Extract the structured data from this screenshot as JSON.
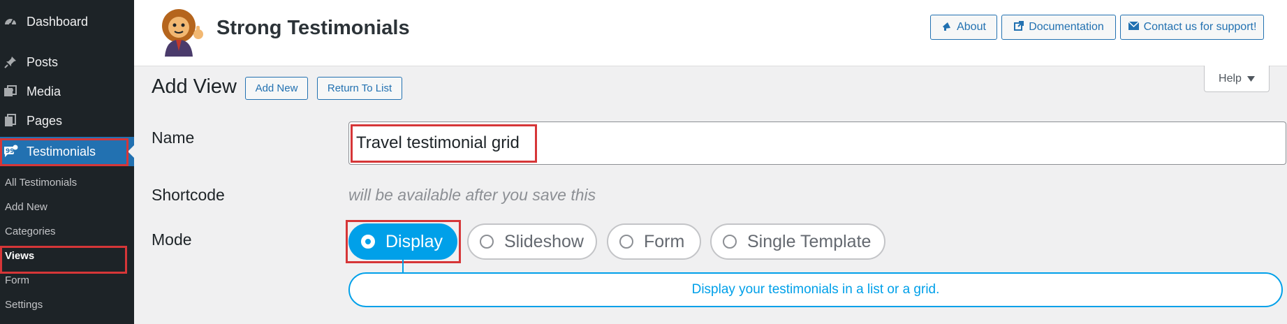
{
  "sidebar": {
    "menu": [
      {
        "label": "Dashboard",
        "icon": "dashboard-icon"
      },
      {
        "label": "Posts",
        "icon": "pushpin-icon"
      },
      {
        "label": "Media",
        "icon": "media-icon"
      },
      {
        "label": "Pages",
        "icon": "pages-icon"
      },
      {
        "label": "Testimonials",
        "icon": "testimonials-icon",
        "active": true
      }
    ],
    "submenu": [
      {
        "label": "All Testimonials"
      },
      {
        "label": "Add New"
      },
      {
        "label": "Categories"
      },
      {
        "label": "Views",
        "current": true
      },
      {
        "label": "Form"
      },
      {
        "label": "Settings"
      }
    ]
  },
  "header": {
    "plugin_title": "Strong Testimonials",
    "buttons": {
      "about": "About",
      "documentation": "Documentation",
      "contact": "Contact us for support!"
    }
  },
  "page": {
    "title": "Add View",
    "add_new": "Add New",
    "return_to_list": "Return To List",
    "help": "Help"
  },
  "form": {
    "name_label": "Name",
    "name_value": "Travel testimonial grid",
    "shortcode_label": "Shortcode",
    "shortcode_note": "will be available after you save this",
    "mode_label": "Mode",
    "modes": [
      {
        "label": "Display",
        "selected": true
      },
      {
        "label": "Slideshow"
      },
      {
        "label": "Form"
      },
      {
        "label": "Single Template"
      }
    ],
    "mode_description": "Display your testimonials in a list or a grid."
  },
  "colors": {
    "sidebar_bg": "#1d2327",
    "active_menu": "#2271b1",
    "accent": "#00a0e9",
    "highlight": "#d63638"
  }
}
